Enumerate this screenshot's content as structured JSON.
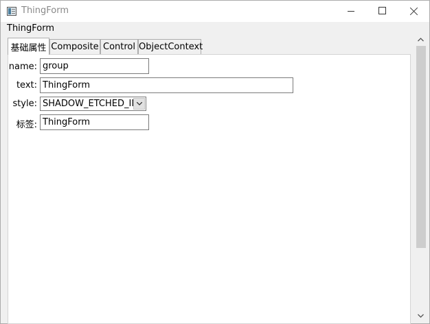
{
  "window": {
    "title": "ThingForm",
    "icon": "app-form-icon"
  },
  "group": {
    "label": "ThingForm"
  },
  "tabs": [
    {
      "label": "基础属性",
      "active": true
    },
    {
      "label": "Composite",
      "active": false
    },
    {
      "label": "Control",
      "active": false
    },
    {
      "label": "ObjectContext",
      "active": false
    }
  ],
  "form": {
    "name_label": "name:",
    "name_value": "group",
    "text_label": "text:",
    "text_value": "ThingForm",
    "style_label": "style:",
    "style_value": "SHADOW_ETCHED_IN",
    "tag_label": "标签:",
    "tag_value": "ThingForm"
  }
}
